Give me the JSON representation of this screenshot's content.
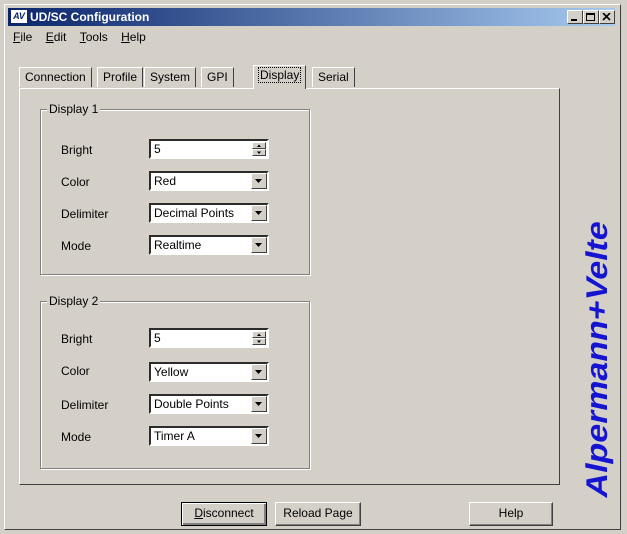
{
  "window": {
    "app_icon_text": "AV",
    "title": "UD/SC Configuration"
  },
  "menu": [
    {
      "hotkey": "F",
      "rest": "ile"
    },
    {
      "hotkey": "E",
      "rest": "dit"
    },
    {
      "hotkey": "T",
      "rest": "ools"
    },
    {
      "hotkey": "H",
      "rest": "elp"
    }
  ],
  "tabs": [
    "Connection",
    "Profile",
    "System",
    "GPI",
    "Display",
    "Serial"
  ],
  "active_tab": "Display",
  "display1": {
    "title": "Display 1",
    "bright_label": "Bright",
    "bright_value": "5",
    "color_label": "Color",
    "color_value": "Red",
    "delimiter_label": "Delimiter",
    "delimiter_value": "Decimal Points",
    "mode_label": "Mode",
    "mode_value": "Realtime"
  },
  "display2": {
    "title": "Display 2",
    "bright_label": "Bright",
    "bright_value": "5",
    "color_label": "Color",
    "color_value": "Yellow",
    "delimiter_label": "Delimiter",
    "delimiter_value": "Double Points",
    "mode_label": "Mode",
    "mode_value": "Timer A"
  },
  "buttons": {
    "disconnect_hotkey": "D",
    "disconnect_rest": "isconnect",
    "reload": "Reload Page",
    "help": "Help"
  },
  "brand_text": "Alpermann+Velte",
  "colors": {
    "brand": "#1414d2",
    "titlebar": "#0a246a",
    "face": "#d4d0c8"
  }
}
